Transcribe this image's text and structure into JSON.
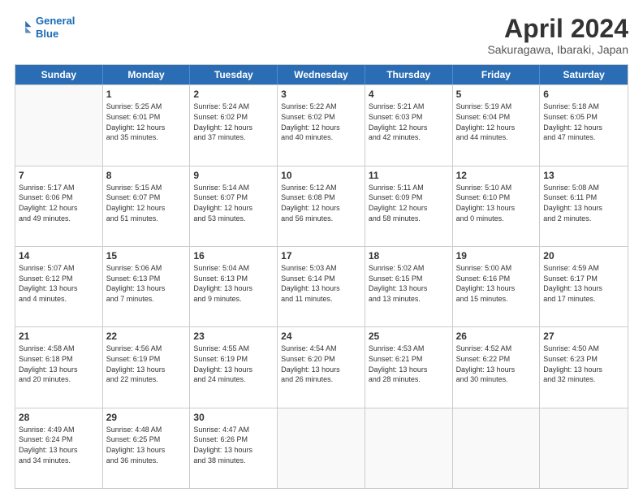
{
  "header": {
    "logo_line1": "General",
    "logo_line2": "Blue",
    "title": "April 2024",
    "location": "Sakuragawa, Ibaraki, Japan"
  },
  "days_of_week": [
    "Sunday",
    "Monday",
    "Tuesday",
    "Wednesday",
    "Thursday",
    "Friday",
    "Saturday"
  ],
  "weeks": [
    [
      {
        "num": "",
        "info": ""
      },
      {
        "num": "1",
        "info": "Sunrise: 5:25 AM\nSunset: 6:01 PM\nDaylight: 12 hours\nand 35 minutes."
      },
      {
        "num": "2",
        "info": "Sunrise: 5:24 AM\nSunset: 6:02 PM\nDaylight: 12 hours\nand 37 minutes."
      },
      {
        "num": "3",
        "info": "Sunrise: 5:22 AM\nSunset: 6:02 PM\nDaylight: 12 hours\nand 40 minutes."
      },
      {
        "num": "4",
        "info": "Sunrise: 5:21 AM\nSunset: 6:03 PM\nDaylight: 12 hours\nand 42 minutes."
      },
      {
        "num": "5",
        "info": "Sunrise: 5:19 AM\nSunset: 6:04 PM\nDaylight: 12 hours\nand 44 minutes."
      },
      {
        "num": "6",
        "info": "Sunrise: 5:18 AM\nSunset: 6:05 PM\nDaylight: 12 hours\nand 47 minutes."
      }
    ],
    [
      {
        "num": "7",
        "info": "Sunrise: 5:17 AM\nSunset: 6:06 PM\nDaylight: 12 hours\nand 49 minutes."
      },
      {
        "num": "8",
        "info": "Sunrise: 5:15 AM\nSunset: 6:07 PM\nDaylight: 12 hours\nand 51 minutes."
      },
      {
        "num": "9",
        "info": "Sunrise: 5:14 AM\nSunset: 6:07 PM\nDaylight: 12 hours\nand 53 minutes."
      },
      {
        "num": "10",
        "info": "Sunrise: 5:12 AM\nSunset: 6:08 PM\nDaylight: 12 hours\nand 56 minutes."
      },
      {
        "num": "11",
        "info": "Sunrise: 5:11 AM\nSunset: 6:09 PM\nDaylight: 12 hours\nand 58 minutes."
      },
      {
        "num": "12",
        "info": "Sunrise: 5:10 AM\nSunset: 6:10 PM\nDaylight: 13 hours\nand 0 minutes."
      },
      {
        "num": "13",
        "info": "Sunrise: 5:08 AM\nSunset: 6:11 PM\nDaylight: 13 hours\nand 2 minutes."
      }
    ],
    [
      {
        "num": "14",
        "info": "Sunrise: 5:07 AM\nSunset: 6:12 PM\nDaylight: 13 hours\nand 4 minutes."
      },
      {
        "num": "15",
        "info": "Sunrise: 5:06 AM\nSunset: 6:13 PM\nDaylight: 13 hours\nand 7 minutes."
      },
      {
        "num": "16",
        "info": "Sunrise: 5:04 AM\nSunset: 6:13 PM\nDaylight: 13 hours\nand 9 minutes."
      },
      {
        "num": "17",
        "info": "Sunrise: 5:03 AM\nSunset: 6:14 PM\nDaylight: 13 hours\nand 11 minutes."
      },
      {
        "num": "18",
        "info": "Sunrise: 5:02 AM\nSunset: 6:15 PM\nDaylight: 13 hours\nand 13 minutes."
      },
      {
        "num": "19",
        "info": "Sunrise: 5:00 AM\nSunset: 6:16 PM\nDaylight: 13 hours\nand 15 minutes."
      },
      {
        "num": "20",
        "info": "Sunrise: 4:59 AM\nSunset: 6:17 PM\nDaylight: 13 hours\nand 17 minutes."
      }
    ],
    [
      {
        "num": "21",
        "info": "Sunrise: 4:58 AM\nSunset: 6:18 PM\nDaylight: 13 hours\nand 20 minutes."
      },
      {
        "num": "22",
        "info": "Sunrise: 4:56 AM\nSunset: 6:19 PM\nDaylight: 13 hours\nand 22 minutes."
      },
      {
        "num": "23",
        "info": "Sunrise: 4:55 AM\nSunset: 6:19 PM\nDaylight: 13 hours\nand 24 minutes."
      },
      {
        "num": "24",
        "info": "Sunrise: 4:54 AM\nSunset: 6:20 PM\nDaylight: 13 hours\nand 26 minutes."
      },
      {
        "num": "25",
        "info": "Sunrise: 4:53 AM\nSunset: 6:21 PM\nDaylight: 13 hours\nand 28 minutes."
      },
      {
        "num": "26",
        "info": "Sunrise: 4:52 AM\nSunset: 6:22 PM\nDaylight: 13 hours\nand 30 minutes."
      },
      {
        "num": "27",
        "info": "Sunrise: 4:50 AM\nSunset: 6:23 PM\nDaylight: 13 hours\nand 32 minutes."
      }
    ],
    [
      {
        "num": "28",
        "info": "Sunrise: 4:49 AM\nSunset: 6:24 PM\nDaylight: 13 hours\nand 34 minutes."
      },
      {
        "num": "29",
        "info": "Sunrise: 4:48 AM\nSunset: 6:25 PM\nDaylight: 13 hours\nand 36 minutes."
      },
      {
        "num": "30",
        "info": "Sunrise: 4:47 AM\nSunset: 6:26 PM\nDaylight: 13 hours\nand 38 minutes."
      },
      {
        "num": "",
        "info": ""
      },
      {
        "num": "",
        "info": ""
      },
      {
        "num": "",
        "info": ""
      },
      {
        "num": "",
        "info": ""
      }
    ]
  ]
}
